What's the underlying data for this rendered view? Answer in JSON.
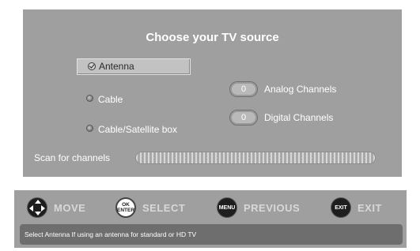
{
  "dialog": {
    "title": "Choose your TV source",
    "options": [
      {
        "label": "Antenna",
        "selected": true
      },
      {
        "label": "Cable",
        "selected": false
      },
      {
        "label": "Cable/Satellite box",
        "selected": false
      }
    ],
    "analog": {
      "count": "0",
      "label": "Analog Channels"
    },
    "digital": {
      "count": "0",
      "label": "Digital Channels"
    },
    "scan": {
      "label": "Scan for channels",
      "progress": 0
    }
  },
  "footer": {
    "nav": [
      {
        "key": "move",
        "icon": "dpad-icon",
        "button_text": "",
        "label": "MOVE"
      },
      {
        "key": "select",
        "icon": "ok-enter-icon",
        "button_text": "OK ENTER",
        "label": "SELECT"
      },
      {
        "key": "previous",
        "icon": "menu-button-icon",
        "button_text": "MENU",
        "label": "PREVIOUS"
      },
      {
        "key": "exit",
        "icon": "exit-button-icon",
        "button_text": "EXIT",
        "label": "EXIT"
      }
    ],
    "help_text": "Select Antenna If using an antenna for standard or HD TV"
  },
  "colors": {
    "panel": "#9f9f9f",
    "help_bar": "#6e6e6e",
    "text": "#ffffff"
  }
}
